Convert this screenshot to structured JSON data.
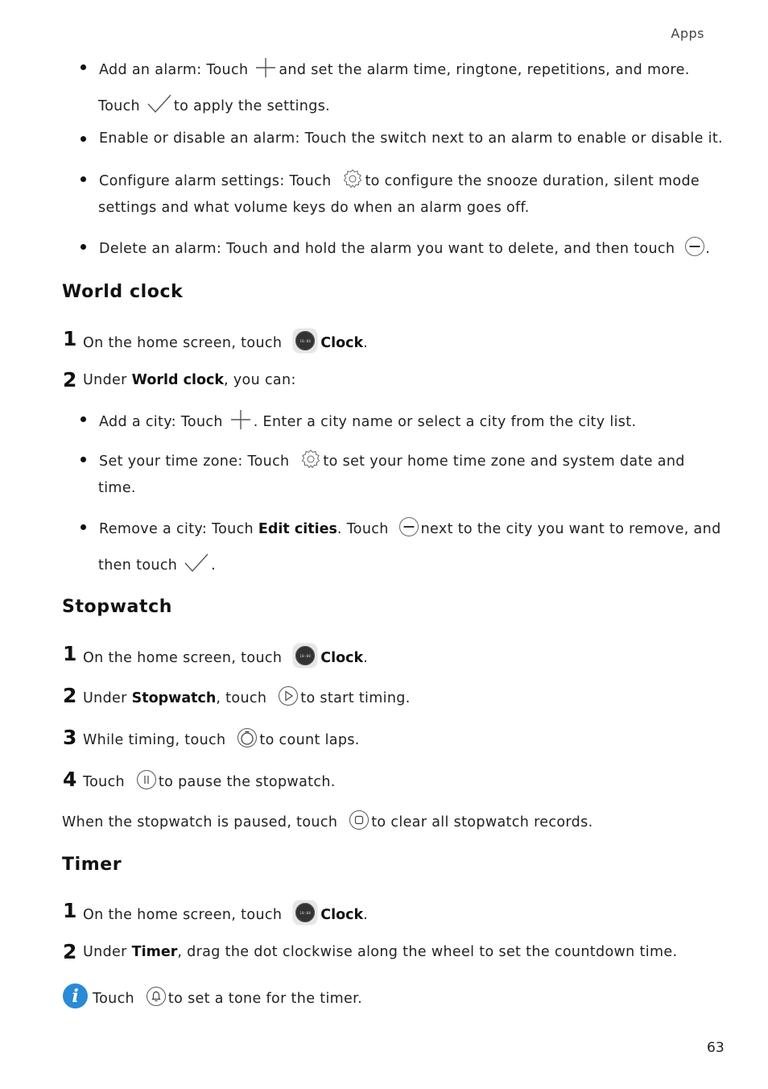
{
  "header": {
    "section": "Apps"
  },
  "page_number": "63",
  "alarm_bullets": [
    {
      "pre": "Add an alarm: Touch",
      "icon": "plus-icon",
      "post": "and set the alarm time, ringtone, repetitions, and more."
    },
    {
      "cont_pre": "Touch",
      "icon": "check-icon",
      "cont_post": "to apply the settings."
    },
    {
      "text": "Enable or disable an alarm: Touch the switch next to an alarm to enable or disable it."
    },
    {
      "pre": "Configure alarm settings: Touch",
      "icon": "settings-gear-icon",
      "post": "to configure the snooze duration, silent mode",
      "cont": "settings and what volume keys do when an alarm goes off."
    },
    {
      "pre": "Delete an alarm: Touch and hold the alarm you want to delete, and then touch",
      "icon": "minus-circle-icon",
      "post": "."
    }
  ],
  "world_clock": {
    "title": "World  clock",
    "steps": [
      {
        "num": "1",
        "pre": "On the home screen, touch",
        "icon": "clock-app-icon",
        "bold": "Clock",
        "post": "."
      },
      {
        "num": "2",
        "pre": "Under",
        "bold": "World clock",
        "post": ", you can:"
      }
    ],
    "bullets": [
      {
        "pre": "Add a city: Touch",
        "icon": "plus-icon",
        "post": ". Enter a city name or select a city from the city list."
      },
      {
        "pre": "Set your time zone: Touch",
        "icon": "settings-gear-icon",
        "post": "to set your home time zone and system date and",
        "cont": "time."
      },
      {
        "pre": "Remove a city: Touch",
        "bold": "Edit cities",
        "mid": ". Touch",
        "icon": "minus-circle-icon",
        "post": "next to the city you want to remove, and",
        "cont_pre": "then touch",
        "cont_icon": "check-icon",
        "cont_post": "."
      }
    ]
  },
  "stopwatch": {
    "title": "Stopwatch",
    "steps": [
      {
        "num": "1",
        "pre": "On the home screen, touch",
        "icon": "clock-app-icon",
        "bold": "Clock",
        "post": "."
      },
      {
        "num": "2",
        "pre": "Under",
        "bold": "Stopwatch",
        "mid": ", touch",
        "icon": "play-icon",
        "post": "to start timing."
      },
      {
        "num": "3",
        "pre": "While timing, touch",
        "icon": "lap-timer-icon",
        "post": "to count laps."
      },
      {
        "num": "4",
        "pre": "Touch",
        "icon": "pause-icon",
        "post": "to pause the stopwatch."
      }
    ],
    "note": {
      "pre": "When the stopwatch is paused, touch",
      "icon": "stop-icon",
      "post": "to clear all stopwatch records."
    }
  },
  "timer": {
    "title": "Timer",
    "steps": [
      {
        "num": "1",
        "pre": "On the home screen, touch",
        "icon": "clock-app-icon",
        "bold": "Clock",
        "post": "."
      },
      {
        "num": "2",
        "pre": "Under",
        "bold": "Timer",
        "post": ", drag the dot clockwise along the wheel to set the countdown time."
      }
    ],
    "tip": {
      "icon": "info-icon",
      "pre": "Touch",
      "icon2": "bell-icon",
      "post": "to set a tone for the timer."
    }
  },
  "colors": {
    "info_blue": "#2a8ad6",
    "text": "#222222"
  }
}
